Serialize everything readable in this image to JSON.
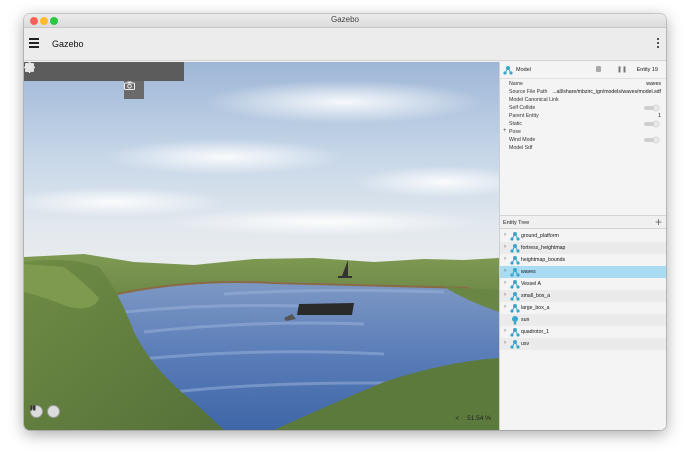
{
  "window": {
    "title": "Gazebo"
  },
  "appbar": {
    "title": "Gazebo"
  },
  "toolbar": {
    "tools": [
      {
        "name": "box-tool",
        "icon": "cube-icon"
      },
      {
        "name": "sphere-tool",
        "icon": "sphere-icon"
      },
      {
        "name": "cylinder-tool",
        "icon": "cylinder-icon"
      },
      {
        "name": "capsule-tool",
        "icon": "capsule-icon"
      },
      {
        "name": "ellipsoid-tool",
        "icon": "ellipsoid-icon"
      },
      {
        "name": "point-light-tool",
        "icon": "sun-icon"
      },
      {
        "name": "directional-light-tool",
        "icon": "directional-light-icon"
      },
      {
        "name": "spot-light-tool",
        "icon": "spotlight-icon"
      }
    ],
    "camera_icon": "camera-icon"
  },
  "component_inspector": {
    "type_label": "Model",
    "entity_label": "Entity 19",
    "rows": [
      {
        "key": "Name",
        "value": "waves"
      },
      {
        "key": "Source File Path",
        "value": "...all/share/mbzirc_ign/models/waves/model.sdf"
      },
      {
        "key": "Model Canonical Link",
        "value": ""
      },
      {
        "key": "Self Collide",
        "value": "",
        "toggle": true
      },
      {
        "key": "Parent Entity",
        "value": "1"
      },
      {
        "key": "Static",
        "value": "",
        "toggle": true
      },
      {
        "key": "Pose",
        "value": "",
        "expander": "+"
      },
      {
        "key": "Wind Mode",
        "value": "",
        "toggle": true
      },
      {
        "key": "Model Sdf",
        "value": ""
      }
    ]
  },
  "entity_tree": {
    "title": "Entity Tree",
    "add_label": "+",
    "items": [
      {
        "label": "ground_platform",
        "icon": "model-icon"
      },
      {
        "label": "fortress_heightmap",
        "icon": "model-icon"
      },
      {
        "label": "heightmap_bounds",
        "icon": "model-icon"
      },
      {
        "label": "waves",
        "icon": "model-icon",
        "selected": true
      },
      {
        "label": "Vessel A",
        "icon": "model-icon"
      },
      {
        "label": "small_box_a",
        "icon": "model-icon"
      },
      {
        "label": "large_box_a",
        "icon": "model-icon"
      },
      {
        "label": "sun",
        "icon": "light-icon"
      },
      {
        "label": "quadrotor_1",
        "icon": "model-icon"
      },
      {
        "label": "usv",
        "icon": "model-icon"
      }
    ]
  },
  "playback": {
    "rtf": "51.54 %",
    "step_label": "<"
  },
  "colors": {
    "selected_row": "#a9dcf2",
    "toolbar": "#5c5c5c",
    "water": "#5b7fb8",
    "grass": "#6e8a45"
  }
}
